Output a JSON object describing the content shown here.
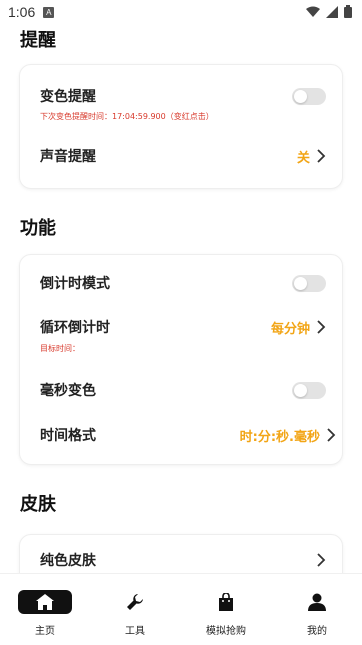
{
  "status_bar": {
    "time": "1:06",
    "badge": "A"
  },
  "sections": {
    "reminder": "提醒",
    "functions": "功能",
    "skin": "皮肤"
  },
  "reminder_card": {
    "color_reminder_label": "变色提醒",
    "color_reminder_on": false,
    "next_color_note": "下次变色提醒时间：17:04:59.900（变红点击）",
    "sound_reminder_label": "声音提醒",
    "sound_reminder_value": "关"
  },
  "functions_card": {
    "countdown_mode_label": "倒计时模式",
    "countdown_mode_on": false,
    "loop_countdown_label": "循环倒计时",
    "loop_countdown_value": "每分钟",
    "target_time_note": "目标时间：",
    "ms_color_label": "毫秒变色",
    "ms_color_on": false,
    "time_format_label": "时间格式",
    "time_format_value": "时:分:秒.毫秒"
  },
  "skin_card": {
    "solid_skin_label": "纯色皮肤"
  },
  "bottom_nav": {
    "home": "主页",
    "tools": "工具",
    "rush_buy": "模拟抢购",
    "mine": "我的"
  },
  "colors": {
    "accent": "#f2a516",
    "note_red": "#d83a2c",
    "toggle_off": "#e3e3e3"
  }
}
